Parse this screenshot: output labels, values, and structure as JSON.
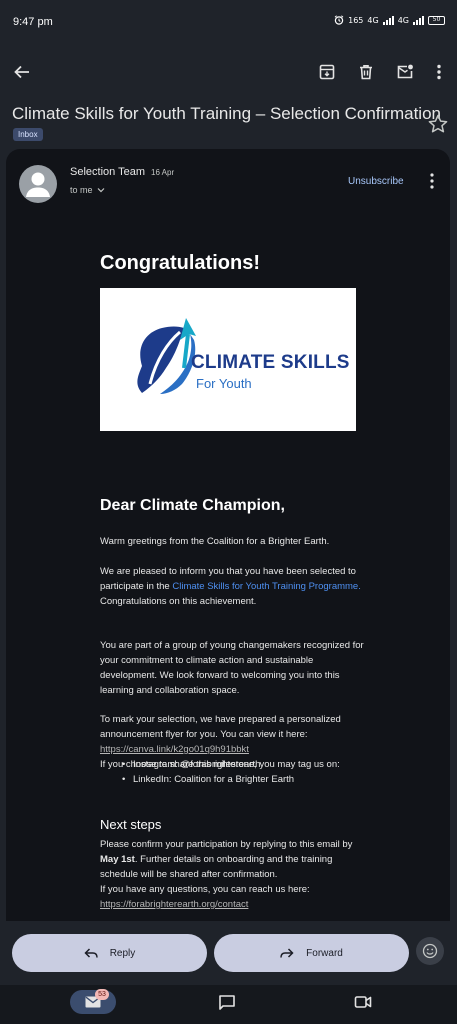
{
  "status_bar": {
    "time": "9:47 pm",
    "speed": "165",
    "net1": "4G",
    "net2": "4G",
    "battery": "50"
  },
  "toolbar": {
    "back_icon": "arrow-left-icon",
    "archive_icon": "archive-icon",
    "delete_icon": "trash-icon",
    "unread_icon": "mark-unread-icon",
    "more_icon": "more-vert-icon"
  },
  "email": {
    "subject": "Climate Skills for Youth Training – Selection Confirmation",
    "label": "Inbox",
    "sender": "Selection Team",
    "date": "16 Apr",
    "recipient": "to me",
    "unsubscribe": "Unsubscribe"
  },
  "body": {
    "heading": "Congratulations!",
    "logo": {
      "title": "CLIMATE SKILLS",
      "subtitle": "For Youth"
    },
    "greeting": "Dear Climate Champion,",
    "p1": "Warm greetings from the Coalition for a Brighter Earth.",
    "p2_text": "We are pleased to inform you that you have been selected to participate in the ",
    "p2_link": "Climate Skills for Youth Training Programme.",
    "p2_end": "Congratulations on this achievement.",
    "p3": "You are part of a group of young changemakers recognized for your commitment to climate action and sustainable development. We look forward to welcoming you into this learning and collaboration space.",
    "p4_text": "To mark your selection, we have prepared a personalized announcement flyer for you. You can view it here: ",
    "p4_link": "https://canva.link/k2go01q9h91bbkt",
    "p4_share": "If you choose to share this milestone, you may tag us on:",
    "bullets": [
      "Instagram: @forabrighterearth",
      "LinkedIn: Coalition for a Brighter Earth"
    ],
    "next_heading": "Next steps",
    "p5_a": "Please confirm your participation by replying to this email by ",
    "p5_bold": "May 1st",
    "p5_b": ". Further details on onboarding and the training schedule will be shared after confirmation.",
    "p6_text": "If you have any questions, you can reach us here:",
    "p6_link": "https://forabrighterearth.org/contact"
  },
  "actions": {
    "reply": "Reply",
    "forward": "Forward"
  },
  "bottom_nav": {
    "mail_count": "53"
  },
  "colors": {
    "background": "#1f232a",
    "card": "#111318",
    "link": "#4e8ff0",
    "accent": "#a8c7fa",
    "pill": "#c9cde1",
    "logo_blue": "#1d3b8a"
  }
}
